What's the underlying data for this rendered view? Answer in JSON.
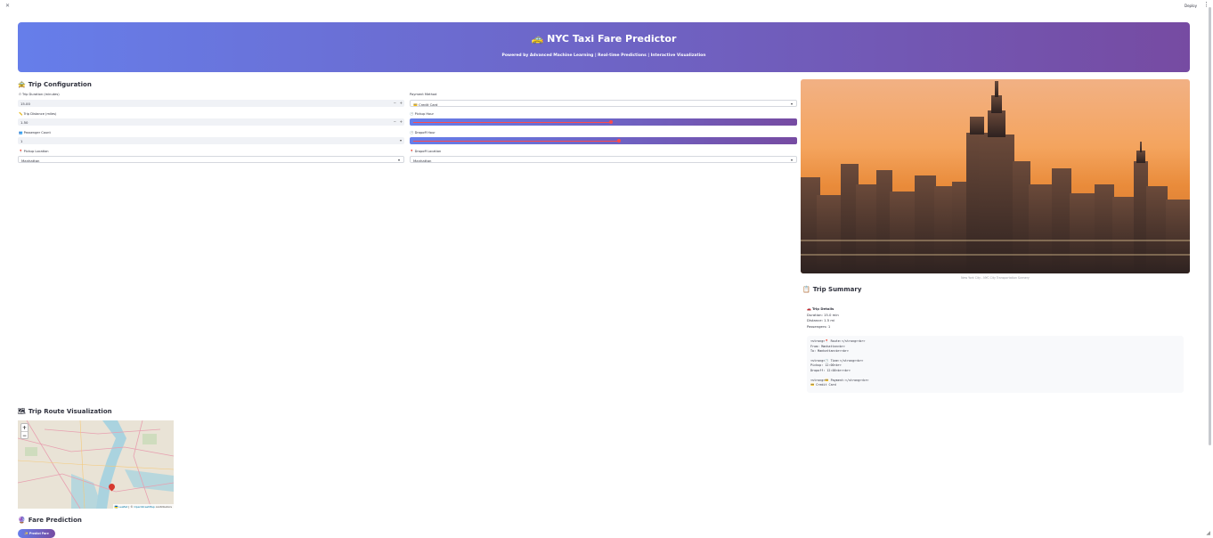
{
  "topbar": {
    "deploy_label": "Deploy",
    "menu_icon": "kebab-menu-icon",
    "close_icon": "close-icon"
  },
  "hero": {
    "title_emoji": "🚕",
    "title": "NYC Taxi Fare Predictor",
    "subtitle": "Powered by Advanced Machine Learning | Real-time Predictions | Interactive Visualization",
    "gradient_start": "#667eea",
    "gradient_end": "#764ba2"
  },
  "trip_config": {
    "icon": "🚖",
    "title": "Trip Configuration",
    "duration": {
      "icon": "⏱",
      "label": "Trip Duration (minutes)",
      "value": "15.00",
      "minus": "−",
      "plus": "+"
    },
    "distance": {
      "icon": "📏",
      "label": "Trip Distance (miles)",
      "value": "1.50",
      "minus": "−",
      "plus": "+"
    },
    "passengers": {
      "icon": "👥",
      "label": "Passenger Count",
      "value": "1",
      "chevron": "▾"
    },
    "pickup_location": {
      "icon": "📍",
      "label": "Pickup Location",
      "value": "Manhattan",
      "chevron": "▾"
    },
    "payment_method": {
      "label": "Payment Method",
      "value_icon": "💳",
      "value": "Credit Card",
      "chevron": "▾"
    },
    "pickup_hour": {
      "icon": "🕐",
      "label": "Pickup Hour",
      "fraction": 0.52
    },
    "dropoff_hour": {
      "icon": "🕐",
      "label": "Dropoff Hour",
      "fraction": 0.54
    },
    "dropoff_location": {
      "icon": "📍",
      "label": "Dropoff Location",
      "value": "Manhattan",
      "chevron": "▾"
    }
  },
  "skyline": {
    "caption": "New York City - NYC City Transportation Scenery"
  },
  "summary": {
    "icon": "📋",
    "title": "Trip Summary",
    "details_icon": "🚗",
    "details_title": "Trip Details",
    "duration_line": "Duration: 15.0 min",
    "distance_line": "Distance: 1.5 mi",
    "passengers_line": "Passengers: 1",
    "code_lines": [
      "<strong>📍 Route:</strong><br>",
      "From: Manhattan<br>",
      "To: Manhattan<br><br>",
      "<strong>🕐 Time:</strong><br>",
      "Pickup: 12:00<br>",
      "Dropoff: 12:00<br><br>",
      "<strong>💳 Payment:</strong><br>",
      "💳 Credit Card"
    ]
  },
  "route_viz": {
    "icon": "🗺",
    "title": "Trip Route Visualization",
    "zoom_in": "+",
    "zoom_out": "−",
    "attribution_flag": "🇺🇦",
    "attribution_leaflet": "Leaflet",
    "attribution_sep": " | © ",
    "attribution_osm": "OpenStreetMap",
    "attribution_tail": " contributors"
  },
  "fare_prediction": {
    "icon": "🔮",
    "title": "Fare Prediction",
    "button_label": "✨ Predict Fare"
  }
}
